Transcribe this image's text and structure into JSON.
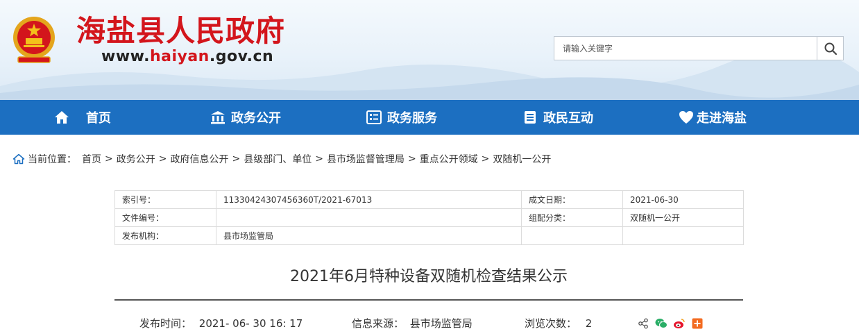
{
  "header": {
    "site_title": "海盐县人民政府",
    "url_prefix": "www.",
    "url_highlight": "haiyan",
    "url_suffix": ".gov.cn",
    "search_placeholder": "请输入关键字"
  },
  "nav": [
    {
      "label": "首页",
      "icon": "home-icon"
    },
    {
      "label": "政务公开",
      "icon": "government-building-icon"
    },
    {
      "label": "政务服务",
      "icon": "service-list-icon"
    },
    {
      "label": "政民互动",
      "icon": "interaction-list-icon"
    },
    {
      "label": "走进海盐",
      "icon": "heart-icon"
    }
  ],
  "breadcrumb": {
    "label": "当前位置：",
    "items": [
      "首页",
      "政务公开",
      "政府信息公开",
      "县级部门、单位",
      "县市场监督管理局",
      "重点公开领域",
      "双随机一公开"
    ],
    "separator": ">"
  },
  "meta": {
    "index_label": "索引号：",
    "index_value": "11330424307456360T/2021-67013",
    "date_label": "成文日期：",
    "date_value": "2021-06-30",
    "doc_no_label": "文件编号：",
    "doc_no_value": "",
    "category_label": "组配分类：",
    "category_value": "双随机一公开",
    "publisher_label": "发布机构：",
    "publisher_value": "县市场监管局"
  },
  "article": {
    "title": "2021年6月特种设备双随机检查结果公示",
    "publish_time_label": "发布时间：",
    "publish_time": "2021- 06- 30 16: 17",
    "source_label": "信息来源：",
    "source": "县市场监管局",
    "views_label": "浏览次数：",
    "views": "2"
  },
  "colors": {
    "brand_red": "#d3151c",
    "nav_blue": "#1c6fc1"
  }
}
